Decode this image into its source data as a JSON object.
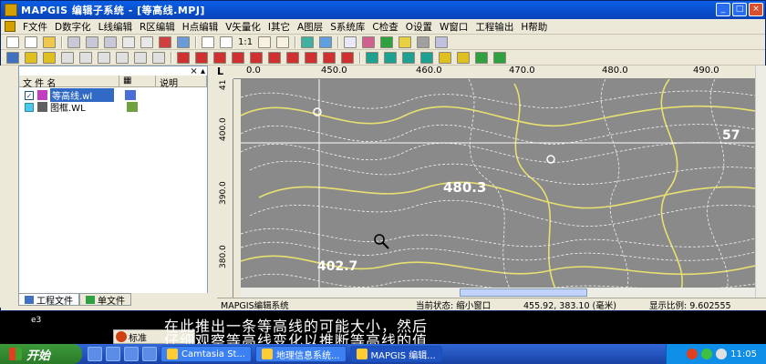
{
  "window": {
    "title": "MAPGIS 编辑子系统 - [等高线.MPJ]"
  },
  "menu": [
    "F文件",
    "D数字化",
    "L线编辑",
    "R区编辑",
    "H点编辑",
    "V矢量化",
    "I其它",
    "A图层",
    "S系统库",
    "C检查",
    "O设置",
    "W窗口",
    "工程输出",
    "H帮助"
  ],
  "toolbar": {
    "zoom_ratio": "1:1"
  },
  "left_panel": {
    "columns": [
      "文 件 名",
      "说明"
    ],
    "files": [
      {
        "name": "等高线.wl",
        "checked": true,
        "selected": true
      },
      {
        "name": "图框.WL",
        "checked": false,
        "selected": false
      }
    ],
    "tabs": [
      "工程文件",
      "单文件"
    ]
  },
  "ruler": {
    "h_ticks": [
      "0.0",
      "450.0",
      "460.0",
      "470.0",
      "480.0",
      "490.0"
    ],
    "v_ticks": [
      "41",
      "400.0",
      "390.0",
      "380.0"
    ]
  },
  "map": {
    "labels": [
      "480.3",
      "402.7",
      "57"
    ]
  },
  "status": {
    "app": "MAPGIS编辑系统",
    "state": "当前状态: 缩小窗口",
    "coords": "455.92, 383.10 (毫米)",
    "scale": "显示比例: 9.602555"
  },
  "subtitle": {
    "line1": "在此推出一条等高线的可能大小，然后",
    "line2": "仔细观察等高线变化以推断等高线的值"
  },
  "ime": {
    "label": "标准"
  },
  "desktop_label": "e3",
  "taskbar": {
    "start": "开始",
    "tasks": [
      "Camtasia St...",
      "地理信息系统...",
      "MAPGIS 编辑..."
    ],
    "clock": "11:05"
  },
  "colors": {
    "contour_yellow": "#e8e070",
    "contour_white": "#f4f4f4",
    "map_bg": "#8a8a8a",
    "title_blue": "#0842b8"
  }
}
